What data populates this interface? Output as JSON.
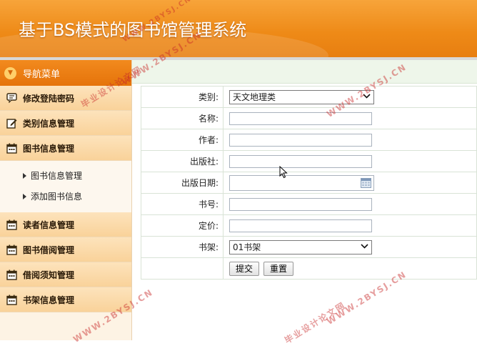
{
  "header": {
    "title": "基于BS模式的图书馆管理系统"
  },
  "sidebar": {
    "nav_title": "导航菜单",
    "items": [
      {
        "label": "修改登陆密码",
        "icon": "message-icon"
      },
      {
        "label": "类别信息管理",
        "icon": "edit-icon"
      },
      {
        "label": "图书信息管理",
        "icon": "calendar-icon",
        "children": [
          {
            "label": "图书信息管理"
          },
          {
            "label": "添加图书信息"
          }
        ]
      },
      {
        "label": "读者信息管理",
        "icon": "calendar-icon"
      },
      {
        "label": "图书借阅管理",
        "icon": "calendar-icon"
      },
      {
        "label": "借阅须知管理",
        "icon": "calendar-icon"
      },
      {
        "label": "书架信息管理",
        "icon": "calendar-icon"
      }
    ]
  },
  "form": {
    "category": {
      "label": "类别:",
      "value": "天文地理类"
    },
    "name": {
      "label": "名称:",
      "value": ""
    },
    "author": {
      "label": "作者:",
      "value": ""
    },
    "publisher": {
      "label": "出版社:",
      "value": ""
    },
    "pub_date": {
      "label": "出版日期:",
      "value": ""
    },
    "book_no": {
      "label": "书号:",
      "value": ""
    },
    "price": {
      "label": "定价:",
      "value": ""
    },
    "shelf": {
      "label": "书架:",
      "value": "01书架"
    },
    "submit_label": "提交",
    "reset_label": "重置"
  },
  "watermarks": {
    "site": "WWW.2BYSJ.CN",
    "cn_text": "毕业设计论文网"
  },
  "colors": {
    "header_orange": "#ee8a17",
    "nav_head": "#e5730a",
    "nav_item": "#fad39c",
    "form_border": "#d9e3d6"
  }
}
